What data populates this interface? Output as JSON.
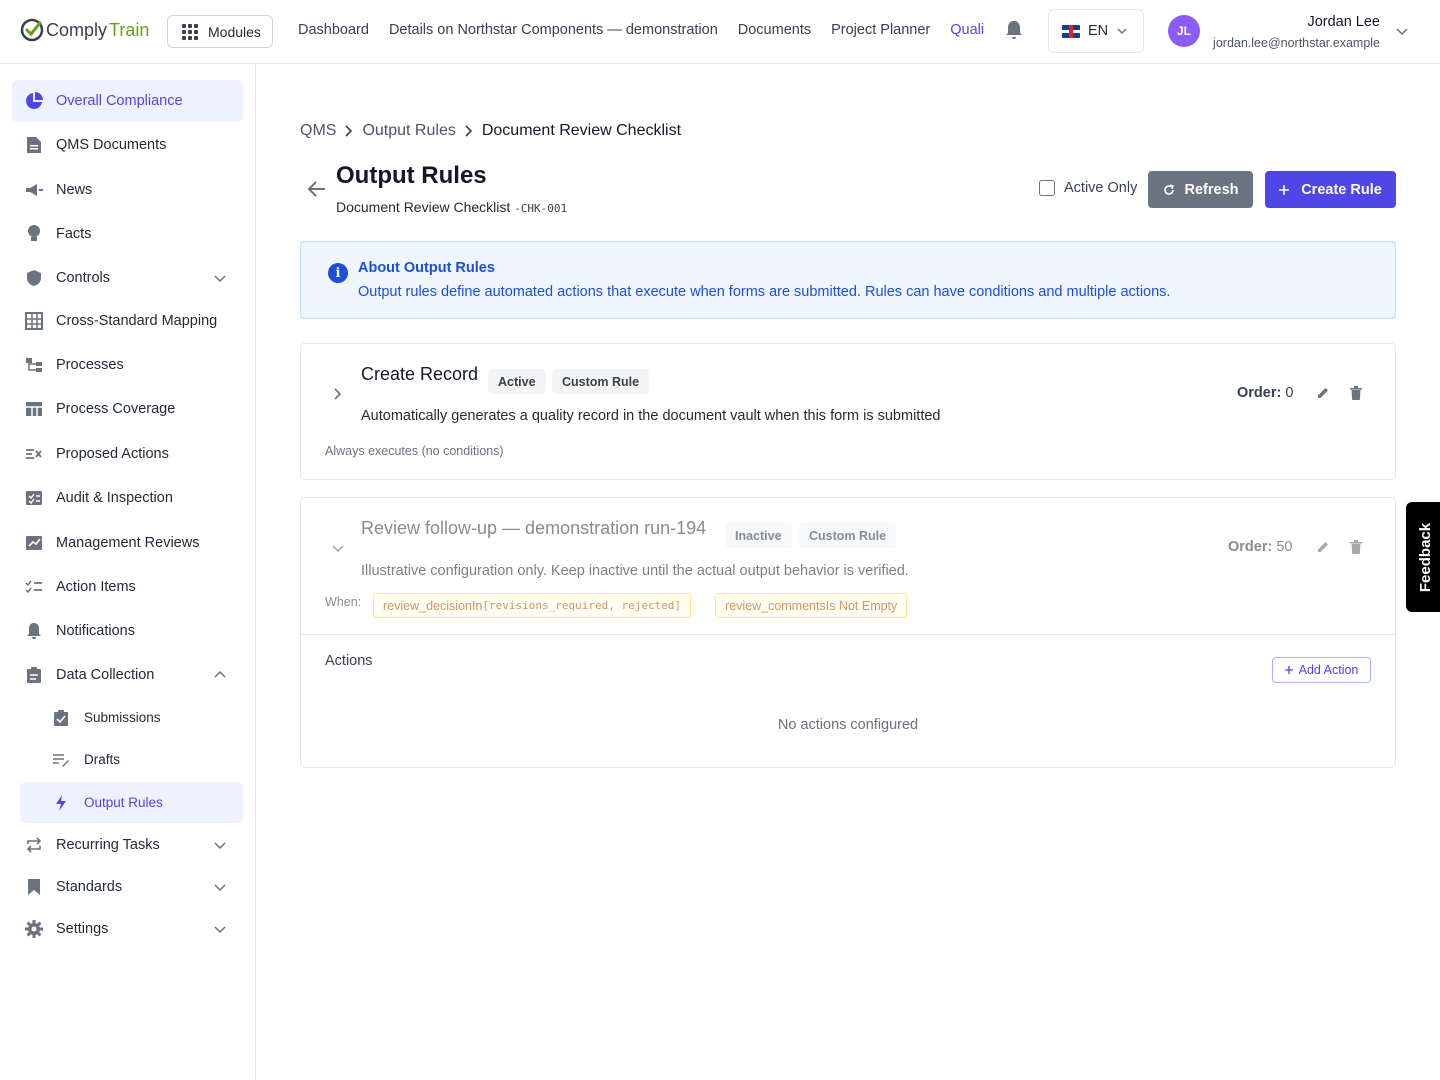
{
  "app": {
    "logo_prefix": "Comply",
    "logo_suffix": "Train"
  },
  "topbar": {
    "modules_label": "Modules",
    "nav": [
      "Dashboard",
      "Details on Northstar Components — demonstration",
      "Documents",
      "Project Planner",
      "Quali"
    ],
    "language": "EN",
    "user": {
      "initials": "JL",
      "name": "Jordan Lee",
      "email": "jordan.lee@northstar.example"
    }
  },
  "sidebar": {
    "items": [
      {
        "label": "Overall Compliance",
        "icon": "pie-chart-icon"
      },
      {
        "label": "QMS Documents",
        "icon": "document-icon"
      },
      {
        "label": "News",
        "icon": "megaphone-icon"
      },
      {
        "label": "Facts",
        "icon": "lightbulb-icon"
      },
      {
        "label": "Controls",
        "icon": "shield-icon"
      },
      {
        "label": "Cross-Standard Mapping",
        "icon": "grid-table-icon"
      },
      {
        "label": "Processes",
        "icon": "hierarchy-icon"
      },
      {
        "label": "Process Coverage",
        "icon": "table-icon"
      },
      {
        "label": "Proposed Actions",
        "icon": "list-check-icon"
      },
      {
        "label": "Audit & Inspection",
        "icon": "checklist-icon"
      },
      {
        "label": "Management Reviews",
        "icon": "chart-review-icon"
      },
      {
        "label": "Action Items",
        "icon": "task-list-icon"
      },
      {
        "label": "Notifications",
        "icon": "bell-icon"
      },
      {
        "label": "Data Collection",
        "icon": "clipboard-icon"
      },
      {
        "label": "Recurring Tasks",
        "icon": "repeat-icon"
      },
      {
        "label": "Standards",
        "icon": "bookmark-icon"
      },
      {
        "label": "Settings",
        "icon": "gear-icon"
      }
    ],
    "sub_items": [
      {
        "label": "Submissions",
        "icon": "clipboard-check-icon"
      },
      {
        "label": "Drafts",
        "icon": "edit-lines-icon"
      },
      {
        "label": "Output Rules",
        "icon": "lightning-icon"
      }
    ]
  },
  "breadcrumb": [
    "QMS",
    "Output Rules",
    "Document Review Checklist"
  ],
  "page": {
    "title": "Output Rules",
    "subtitle": "Document Review Checklist",
    "code": "-CHK-001",
    "active_only_label": "Active Only",
    "refresh_label": "Refresh",
    "create_label": "Create Rule"
  },
  "info": {
    "title": "About Output Rules",
    "text": "Output rules define automated actions that execute when forms are submitted. Rules can have conditions and multiple actions."
  },
  "rules": [
    {
      "title": "Create Record",
      "status": "Active",
      "type": "Custom Rule",
      "description": "Automatically generates a quality record in the document vault when this form is submitted",
      "order_label": "Order:",
      "order": "0",
      "conditions_text": "Always executes (no conditions)"
    },
    {
      "title": "Review follow-up — demonstration run-194",
      "status": "Inactive",
      "type": "Custom Rule",
      "description": "Illustrative configuration only. Keep inactive until the actual output behavior is verified.",
      "order_label": "Order:",
      "order": "50",
      "when_label": "When:",
      "conditions": [
        {
          "field": "review_decision",
          "op": "In",
          "value": "[revisions_required, rejected]"
        },
        {
          "field": "review_comments",
          "op": "Is Not Empty",
          "value": ""
        }
      ],
      "actions_label": "Actions",
      "add_action_label": "Add Action",
      "no_actions_text": "No actions configured"
    }
  ],
  "feedback_label": "Feedback",
  "colors": {
    "accent": "#4f46e5",
    "info": "#1d4ed8",
    "brand_green": "#65a30d"
  }
}
